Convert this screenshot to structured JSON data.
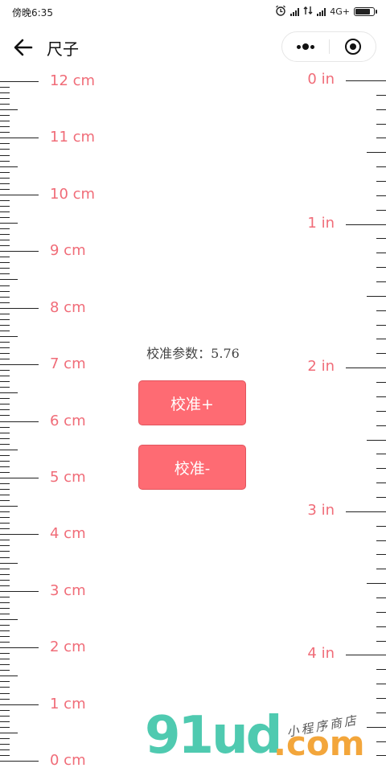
{
  "status_bar": {
    "time": "傍晚6:35",
    "network": "4G+"
  },
  "nav": {
    "title": "尺子",
    "icons": [
      "back-arrow-icon",
      "more-icon",
      "close-target-icon"
    ]
  },
  "ruler_cm": {
    "unit": "cm",
    "labels": [
      "12 cm",
      "11 cm",
      "10 cm",
      "9 cm",
      "8 cm",
      "7 cm",
      "6 cm",
      "5 cm",
      "4 cm",
      "3 cm",
      "2 cm",
      "1 cm",
      "0 cm"
    ],
    "max": 12,
    "minor_per_unit": 10
  },
  "ruler_in": {
    "unit": "in",
    "labels": [
      "0 in",
      "1 in",
      "2 in",
      "3 in",
      "4 in"
    ],
    "max": 4,
    "minor_per_unit": 10
  },
  "calibration": {
    "text": "校准参数：5.76",
    "value": 5.76,
    "plus_label": "校准+",
    "minus_label": "校准-"
  },
  "watermark": {
    "brand": "91ud",
    "domain": ".com",
    "tagline": "小程序商店"
  },
  "colors": {
    "label": "#f06c78",
    "button": "#fe6b73",
    "watermark_green": "#4fcab0",
    "watermark_orange": "#f3a63b"
  }
}
